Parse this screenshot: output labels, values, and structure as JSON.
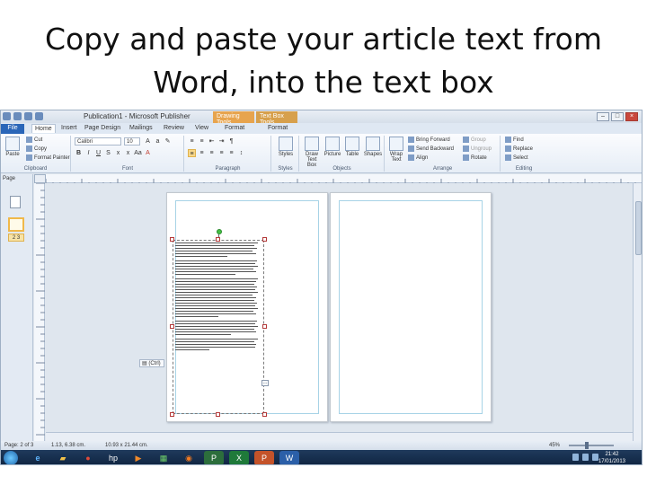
{
  "slide": {
    "title": "Copy and paste your article text from Word, into the text box"
  },
  "titlebar": {
    "app_title": "Publication1 - Microsoft Publisher",
    "context_drawing": "Drawing Tools",
    "context_textbox": "Text Box Tools"
  },
  "tabs": [
    {
      "label": "File"
    },
    {
      "label": "Home"
    },
    {
      "label": "Insert"
    },
    {
      "label": "Page Design"
    },
    {
      "label": "Mailings"
    },
    {
      "label": "Review"
    },
    {
      "label": "View"
    },
    {
      "label": "Format"
    },
    {
      "label": "Format"
    }
  ],
  "ribbon": {
    "clipboard": {
      "paste": "Paste",
      "cut": "Cut",
      "copy": "Copy",
      "format_painter": "Format Painter",
      "label": "Clipboard"
    },
    "font": {
      "font_name": "Calibri",
      "font_size": "10",
      "label": "Font"
    },
    "paragraph": {
      "label": "Paragraph"
    },
    "styles": {
      "styles": "Styles",
      "label": "Styles"
    },
    "objects": {
      "draw_text_box": "Draw Text Box",
      "picture": "Picture",
      "table": "Table",
      "shapes": "Shapes",
      "label": "Objects"
    },
    "arrange": {
      "wrap_text": "Wrap Text",
      "bring_forward": "Bring Forward",
      "send_backward": "Send Backward",
      "align": "Align",
      "group": "Group",
      "ungroup": "Ungroup",
      "rotate": "Rotate",
      "label": "Arrange"
    },
    "editing": {
      "find": "Find",
      "replace": "Replace",
      "select": "Select",
      "label": "Editing"
    }
  },
  "left_panel": {
    "header": "Page"
  },
  "status": {
    "page": "Page: 2 of 3",
    "position": "1.13, 6.38 cm.",
    "size": "10.93 x 21.44 cm.",
    "zoom": "45%"
  },
  "paste_options": {
    "label": "(Ctrl)"
  },
  "taskbar": {
    "time": "21:42",
    "date": "17/01/2013"
  },
  "colors": {
    "file_tab": "#2a66b8",
    "drawing_tools": "#e7a44e",
    "selection_handle": "#b43a3a",
    "rotate_handle": "#44c045",
    "taskbar": "#1f3a5c"
  },
  "icons": [
    "paste-icon",
    "cut-icon",
    "copy-icon",
    "format-painter-icon",
    "picture-icon",
    "table-icon",
    "shapes-icon",
    "find-icon",
    "start-icon",
    "ie-icon",
    "explorer-icon",
    "chrome-icon",
    "hp-icon",
    "media-icon",
    "firefox-icon",
    "publisher-icon",
    "excel-icon",
    "powerpoint-icon",
    "word-icon"
  ]
}
